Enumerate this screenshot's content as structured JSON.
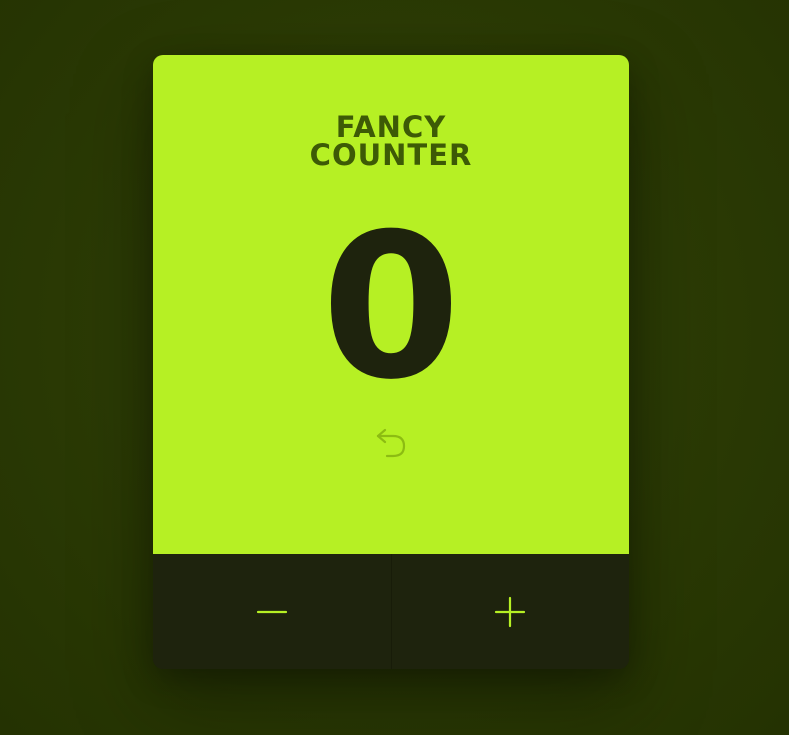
{
  "counter": {
    "title_line1": "FANCY",
    "title_line2": "COUNTER",
    "value": "0"
  },
  "icons": {
    "reset": "undo-arrow-icon",
    "decrement": "minus-icon",
    "increment": "plus-icon"
  },
  "colors": {
    "accent": "#b6f024",
    "title": "#3d5a06",
    "count": "#1e230d",
    "controls_bg": "#1e230d",
    "control_icon": "#b6f024",
    "background": "#2c3c05"
  }
}
